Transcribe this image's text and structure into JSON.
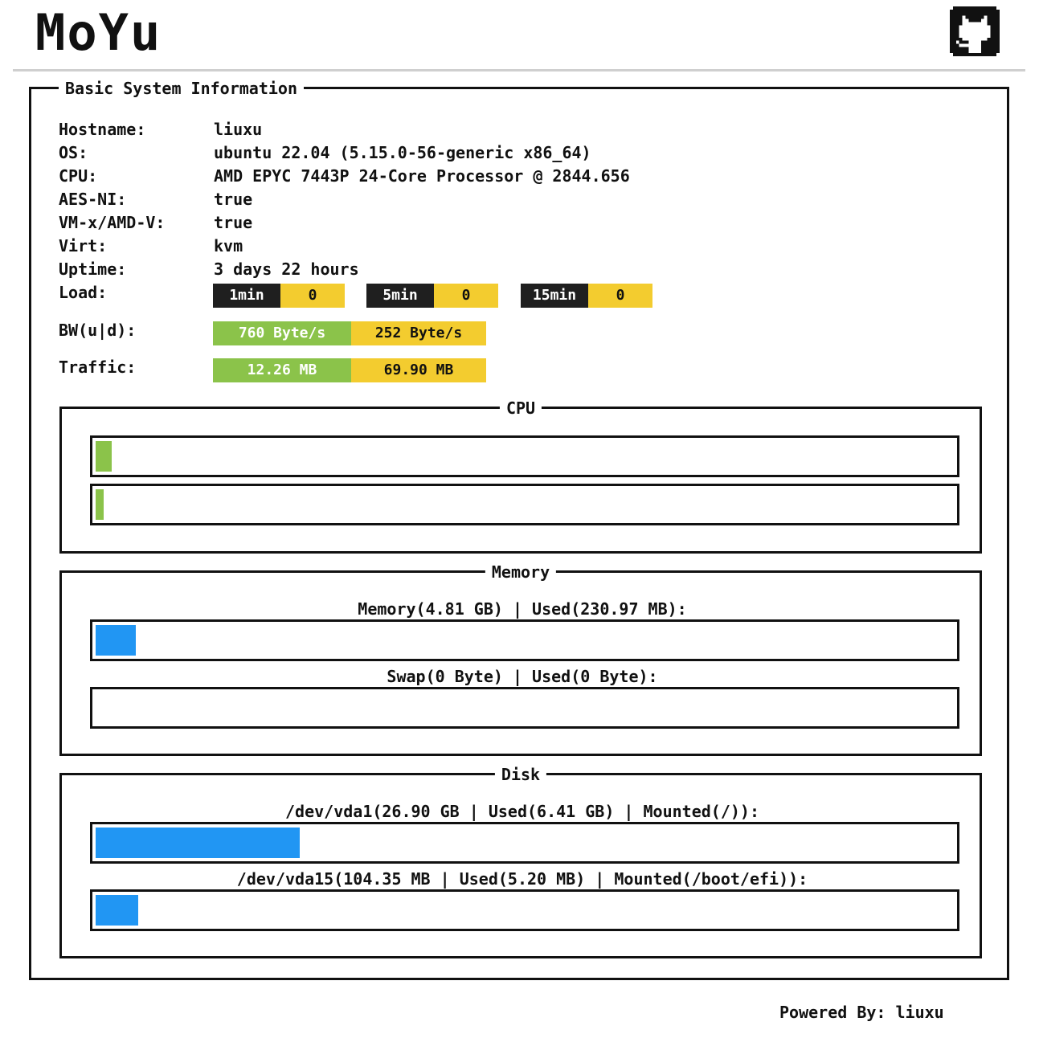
{
  "header": {
    "logo": "MoYu",
    "github_icon": "github-icon"
  },
  "basic": {
    "title": "Basic System Information",
    "rows": [
      {
        "key": "Hostname:",
        "value": "liuxu"
      },
      {
        "key": "OS:",
        "value": "ubuntu 22.04 (5.15.0-56-generic x86_64)"
      },
      {
        "key": "CPU:",
        "value": "AMD EPYC 7443P 24-Core Processor @ 2844.656"
      },
      {
        "key": "AES-NI:",
        "value": "true"
      },
      {
        "key": "VM-x/AMD-V:",
        "value": "true"
      },
      {
        "key": "Virt:",
        "value": "kvm"
      },
      {
        "key": "Uptime:",
        "value": "3 days 22 hours"
      }
    ],
    "load_label": "Load:",
    "load": [
      {
        "label": "1min",
        "value": "0"
      },
      {
        "label": "5min",
        "value": "0"
      },
      {
        "label": "15min",
        "value": "0"
      }
    ],
    "bw_label": "BW(u|d):",
    "bw_up": "760 Byte/s",
    "bw_down": "252 Byte/s",
    "traffic_label": "Traffic:",
    "traffic_up": "12.26 MB",
    "traffic_down": "69.90 MB"
  },
  "cpu": {
    "title": "CPU",
    "cores": [
      {
        "usage_fraction": 0.019
      },
      {
        "usage_fraction": 0.009
      }
    ]
  },
  "memory": {
    "title": "Memory",
    "mem_caption": "Memory(4.81 GB) | Used(230.97 MB):",
    "mem_fraction": 0.047,
    "swap_caption": "Swap(0 Byte) | Used(0 Byte):",
    "swap_fraction": 0
  },
  "disk": {
    "title": "Disk",
    "items": [
      {
        "caption": "/dev/vda1(26.90 GB | Used(6.41 GB) | Mounted(/)):",
        "fraction": 0.238
      },
      {
        "caption": "/dev/vda15(104.35 MB | Used(5.20 MB) | Mounted(/boot/efi)):",
        "fraction": 0.05
      }
    ]
  },
  "footer": {
    "text": "Powered By: liuxu"
  },
  "colors": {
    "green": "#8bc34a",
    "yellow": "#f3cc2f",
    "blue": "#2196f3",
    "dark": "#1f1f1f"
  }
}
